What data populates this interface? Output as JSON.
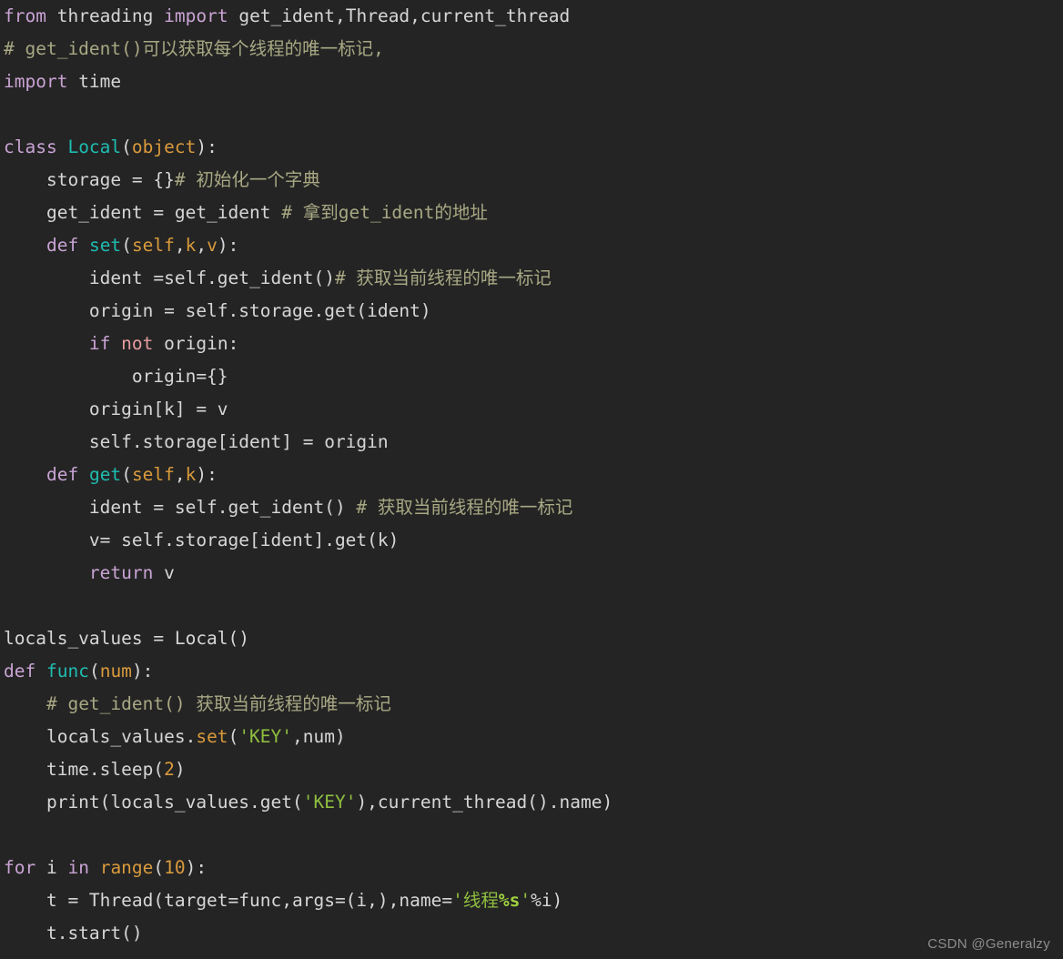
{
  "editor": {
    "background_color": "#242424",
    "default_text_color": "#d6d6d6",
    "language": "python",
    "font_size_px": 19.5,
    "line_height_px": 36
  },
  "palette": {
    "keyword": "#c9a3d4",
    "operator_keyword": "#e59ca0",
    "function_name": "#1fbcb0",
    "parameter": "#d99a3c",
    "number": "#d99a3c",
    "builtin": "#d99a3c",
    "comment": "#a8a884",
    "string": "#8fbf3f",
    "format_spec": "#9ed13f",
    "plain": "#d6d6d6",
    "watermark": "#8d8d8d"
  },
  "watermark": {
    "text": "CSDN @Generalzy"
  },
  "code": {
    "lines": [
      {
        "index": 1,
        "text": "from threading import get_ident,Thread,current_thread",
        "tokens": [
          {
            "text": "from",
            "kind": "kw"
          },
          {
            "text": " ",
            "kind": "plain"
          },
          {
            "text": "threading",
            "kind": "plain"
          },
          {
            "text": " ",
            "kind": "plain"
          },
          {
            "text": "import",
            "kind": "kw"
          },
          {
            "text": " get_ident,Thread,current_thread",
            "kind": "plain"
          }
        ]
      },
      {
        "index": 2,
        "text": "# get_ident()可以获取每个线程的唯一标记,",
        "tokens": [
          {
            "text": "# get_ident()可以获取每个线程的唯一标记,",
            "kind": "comment"
          }
        ]
      },
      {
        "index": 3,
        "text": "import time",
        "tokens": [
          {
            "text": "import",
            "kind": "kw"
          },
          {
            "text": " time",
            "kind": "plain"
          }
        ]
      },
      {
        "index": 4,
        "text": "",
        "tokens": [
          {
            "text": " ",
            "kind": "blank"
          }
        ]
      },
      {
        "index": 5,
        "text": "class Local(object):",
        "tokens": [
          {
            "text": "class",
            "kind": "kw"
          },
          {
            "text": " ",
            "kind": "plain"
          },
          {
            "text": "Local",
            "kind": "fn"
          },
          {
            "text": "(",
            "kind": "plain"
          },
          {
            "text": "object",
            "kind": "builtin"
          },
          {
            "text": "):",
            "kind": "plain"
          }
        ]
      },
      {
        "index": 6,
        "text": "    storage = {}# 初始化一个字典",
        "tokens": [
          {
            "text": "    storage = {}",
            "kind": "plain"
          },
          {
            "text": "# 初始化一个字典",
            "kind": "comment"
          }
        ]
      },
      {
        "index": 7,
        "text": "    get_ident = get_ident # 拿到get_ident的地址",
        "tokens": [
          {
            "text": "    get_ident = get_ident ",
            "kind": "plain"
          },
          {
            "text": "# 拿到get_ident的地址",
            "kind": "comment"
          }
        ]
      },
      {
        "index": 8,
        "text": "    def set(self,k,v):",
        "tokens": [
          {
            "text": "    ",
            "kind": "plain"
          },
          {
            "text": "def",
            "kind": "kw"
          },
          {
            "text": " ",
            "kind": "plain"
          },
          {
            "text": "set",
            "kind": "fn"
          },
          {
            "text": "(",
            "kind": "plain"
          },
          {
            "text": "self",
            "kind": "param"
          },
          {
            "text": ",",
            "kind": "plain"
          },
          {
            "text": "k",
            "kind": "param"
          },
          {
            "text": ",",
            "kind": "plain"
          },
          {
            "text": "v",
            "kind": "param"
          },
          {
            "text": "):",
            "kind": "plain"
          }
        ]
      },
      {
        "index": 9,
        "text": "        ident =self.get_ident()# 获取当前线程的唯一标记",
        "tokens": [
          {
            "text": "        ident =self.get_ident()",
            "kind": "plain"
          },
          {
            "text": "# 获取当前线程的唯一标记",
            "kind": "comment"
          }
        ]
      },
      {
        "index": 10,
        "text": "        origin = self.storage.get(ident)",
        "tokens": [
          {
            "text": "        origin = self.storage.get(ident)",
            "kind": "plain"
          }
        ]
      },
      {
        "index": 11,
        "text": "        if not origin:",
        "tokens": [
          {
            "text": "        ",
            "kind": "plain"
          },
          {
            "text": "if",
            "kind": "kw"
          },
          {
            "text": " ",
            "kind": "plain"
          },
          {
            "text": "not",
            "kind": "op-kw"
          },
          {
            "text": " origin:",
            "kind": "plain"
          }
        ]
      },
      {
        "index": 12,
        "text": "            origin={}",
        "tokens": [
          {
            "text": "            origin={}",
            "kind": "plain"
          }
        ]
      },
      {
        "index": 13,
        "text": "        origin[k] = v",
        "tokens": [
          {
            "text": "        origin[k] = v",
            "kind": "plain"
          }
        ]
      },
      {
        "index": 14,
        "text": "        self.storage[ident] = origin",
        "tokens": [
          {
            "text": "        self.storage[ident] = origin",
            "kind": "plain"
          }
        ]
      },
      {
        "index": 15,
        "text": "    def get(self,k):",
        "tokens": [
          {
            "text": "    ",
            "kind": "plain"
          },
          {
            "text": "def",
            "kind": "kw"
          },
          {
            "text": " ",
            "kind": "plain"
          },
          {
            "text": "get",
            "kind": "fn"
          },
          {
            "text": "(",
            "kind": "plain"
          },
          {
            "text": "self",
            "kind": "param"
          },
          {
            "text": ",",
            "kind": "plain"
          },
          {
            "text": "k",
            "kind": "param"
          },
          {
            "text": "):",
            "kind": "plain"
          }
        ]
      },
      {
        "index": 16,
        "text": "        ident = self.get_ident() # 获取当前线程的唯一标记",
        "tokens": [
          {
            "text": "        ident = self.get_ident() ",
            "kind": "plain"
          },
          {
            "text": "# 获取当前线程的唯一标记",
            "kind": "comment"
          }
        ]
      },
      {
        "index": 17,
        "text": "        v= self.storage[ident].get(k)",
        "tokens": [
          {
            "text": "        v= self.storage[ident].get(k)",
            "kind": "plain"
          }
        ]
      },
      {
        "index": 18,
        "text": "        return v",
        "tokens": [
          {
            "text": "        ",
            "kind": "plain"
          },
          {
            "text": "return",
            "kind": "kw"
          },
          {
            "text": " v",
            "kind": "plain"
          }
        ]
      },
      {
        "index": 19,
        "text": "",
        "tokens": [
          {
            "text": " ",
            "kind": "blank"
          }
        ]
      },
      {
        "index": 20,
        "text": "locals_values = Local()",
        "tokens": [
          {
            "text": "locals_values = Local()",
            "kind": "plain"
          }
        ]
      },
      {
        "index": 21,
        "text": "def func(num):",
        "tokens": [
          {
            "text": "def",
            "kind": "kw"
          },
          {
            "text": " ",
            "kind": "plain"
          },
          {
            "text": "func",
            "kind": "fn"
          },
          {
            "text": "(",
            "kind": "plain"
          },
          {
            "text": "num",
            "kind": "param"
          },
          {
            "text": "):",
            "kind": "plain"
          }
        ]
      },
      {
        "index": 22,
        "text": "    # get_ident() 获取当前线程的唯一标记",
        "tokens": [
          {
            "text": "    ",
            "kind": "plain"
          },
          {
            "text": "# get_ident() 获取当前线程的唯一标记",
            "kind": "comment"
          }
        ]
      },
      {
        "index": 23,
        "text": "    locals_values.set('KEY',num)",
        "tokens": [
          {
            "text": "    locals_values.",
            "kind": "plain"
          },
          {
            "text": "set",
            "kind": "builtin"
          },
          {
            "text": "(",
            "kind": "plain"
          },
          {
            "text": "'KEY'",
            "kind": "string"
          },
          {
            "text": ",num)",
            "kind": "plain"
          }
        ]
      },
      {
        "index": 24,
        "text": "    time.sleep(2)",
        "tokens": [
          {
            "text": "    time.sleep(",
            "kind": "plain"
          },
          {
            "text": "2",
            "kind": "num"
          },
          {
            "text": ")",
            "kind": "plain"
          }
        ]
      },
      {
        "index": 25,
        "text": "    print(locals_values.get('KEY'),current_thread().name)",
        "tokens": [
          {
            "text": "    print(locals_values.get(",
            "kind": "plain"
          },
          {
            "text": "'KEY'",
            "kind": "string"
          },
          {
            "text": "),current_thread().name)",
            "kind": "plain"
          }
        ]
      },
      {
        "index": 26,
        "text": "",
        "tokens": [
          {
            "text": " ",
            "kind": "blank"
          }
        ]
      },
      {
        "index": 27,
        "text": "for i in range(10):",
        "tokens": [
          {
            "text": "for",
            "kind": "kw"
          },
          {
            "text": " i ",
            "kind": "plain"
          },
          {
            "text": "in",
            "kind": "kw"
          },
          {
            "text": " ",
            "kind": "plain"
          },
          {
            "text": "range",
            "kind": "builtin"
          },
          {
            "text": "(",
            "kind": "plain"
          },
          {
            "text": "10",
            "kind": "num"
          },
          {
            "text": "):",
            "kind": "plain"
          }
        ]
      },
      {
        "index": 28,
        "text": "    t = Thread(target=func,args=(i,),name='线程%s'%i)",
        "tokens": [
          {
            "text": "    t = Thread(target=func,args=(i,),name=",
            "kind": "plain"
          },
          {
            "text": "'线程",
            "kind": "string"
          },
          {
            "text": "%s",
            "kind": "fmt"
          },
          {
            "text": "'",
            "kind": "string"
          },
          {
            "text": "%i)",
            "kind": "plain"
          }
        ]
      },
      {
        "index": 29,
        "text": "    t.start()",
        "tokens": [
          {
            "text": "    t.start()",
            "kind": "plain"
          }
        ]
      }
    ]
  }
}
